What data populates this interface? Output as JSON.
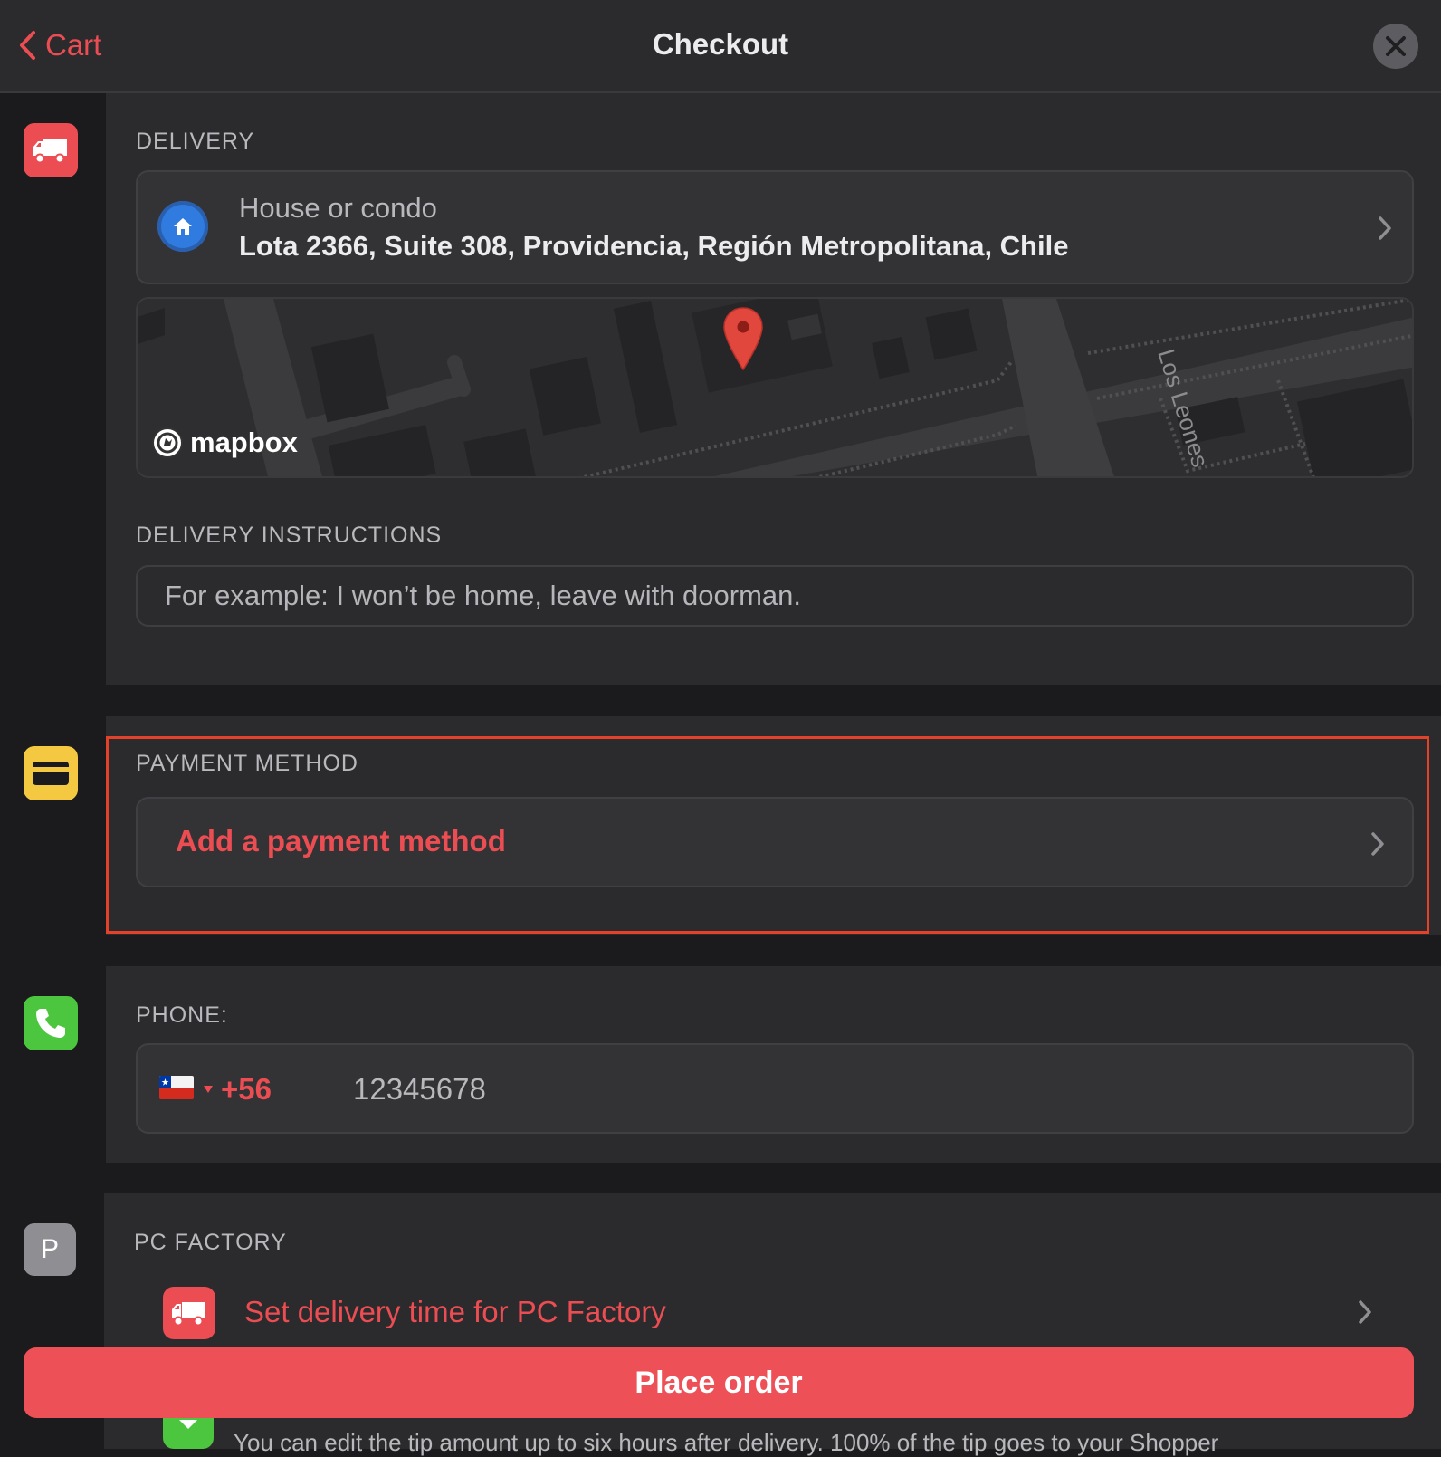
{
  "header": {
    "back_label": "Cart",
    "title": "Checkout"
  },
  "delivery": {
    "section_label": "DELIVERY",
    "address_type": "House or condo",
    "address": "Lota 2366, Suite 308, Providencia, Región Metropolitana, Chile",
    "map": {
      "street_label": "Los Leones",
      "attribution": "mapbox"
    },
    "instructions_label": "DELIVERY INSTRUCTIONS",
    "instructions_placeholder": "For example: I won’t be home, leave with doorman."
  },
  "payment": {
    "section_label": "PAYMENT METHOD",
    "add_label": "Add a payment method"
  },
  "phone": {
    "section_label": "PHONE:",
    "country_code": "+56",
    "number": "12345678"
  },
  "vendor": {
    "initial": "P",
    "section_label": "PC FACTORY",
    "delivery_time_label": "Set delivery time for PC Factory"
  },
  "footer": {
    "place_order_label": "Place order",
    "tip_note": "You can edit the tip amount up to six hours after delivery. 100% of the tip goes to your Shopper"
  },
  "colors": {
    "accent": "#ec4d52",
    "background": "#1b1b1d",
    "panel": "#2b2b2e",
    "delivery_icon": "#ec4d52",
    "payment_icon": "#f5c842",
    "phone_icon": "#4cc63e",
    "vendor_icon": "#8e8e93",
    "highlight": "#e4412b"
  },
  "icons": {
    "back": "chevron-left-icon",
    "close": "close-icon",
    "delivery": "truck-icon",
    "address": "home-icon",
    "payment": "credit-card-icon",
    "phone": "phone-icon",
    "map_pin": "map-pin-icon"
  }
}
